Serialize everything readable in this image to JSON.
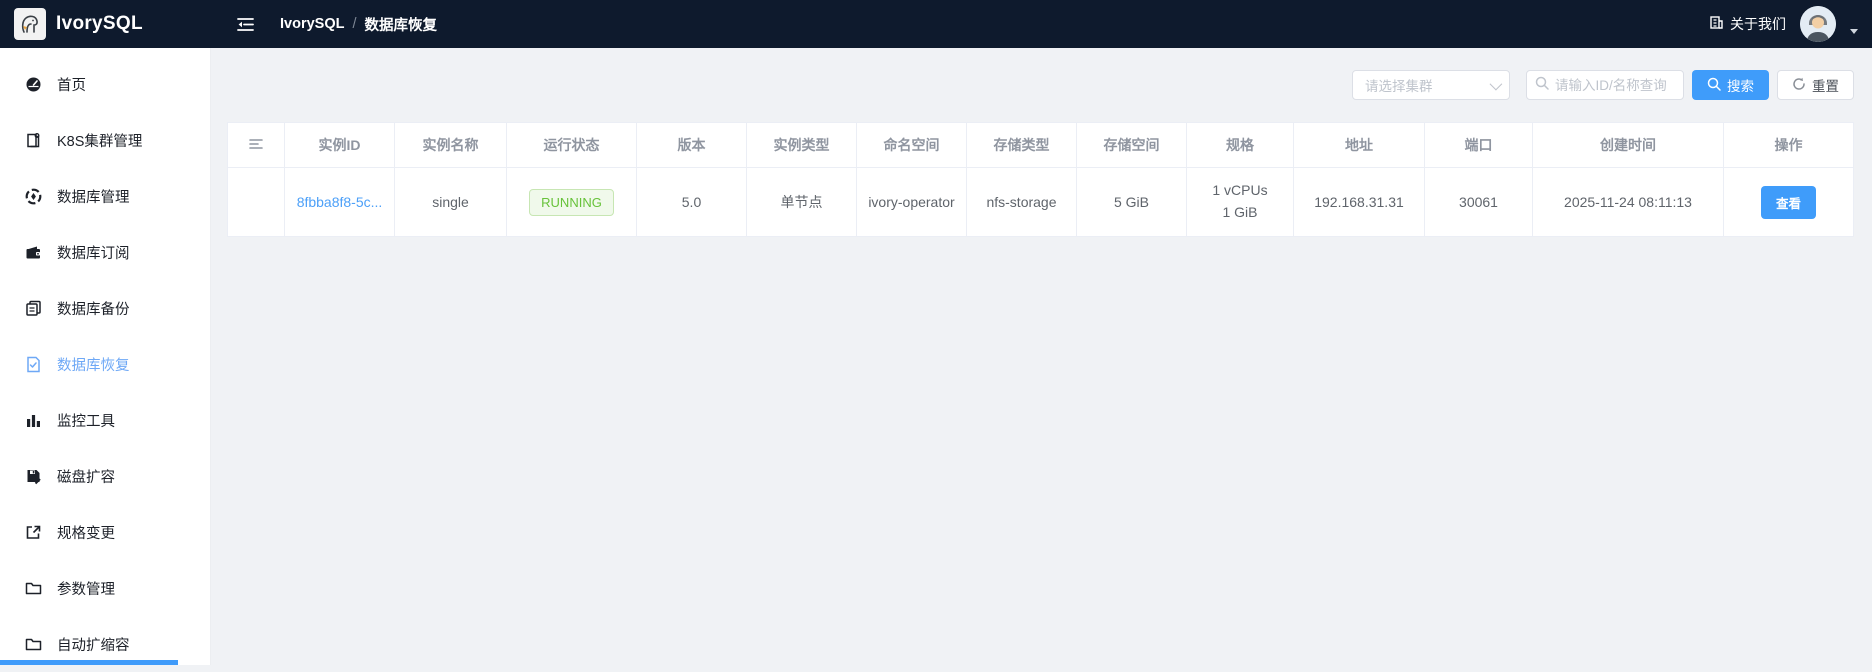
{
  "topbar": {
    "logo_text": "IvorySQL",
    "breadcrumb": {
      "root": "IvorySQL",
      "separator": "/",
      "current": "数据库恢复"
    },
    "about_label": "关于我们"
  },
  "sidebar": {
    "items": [
      {
        "label": "首页",
        "icon": "home-dashboard-icon",
        "active": false
      },
      {
        "label": "K8S集群管理",
        "icon": "k8s-cluster-icon",
        "active": false
      },
      {
        "label": "数据库管理",
        "icon": "database-manage-icon",
        "active": false
      },
      {
        "label": "数据库订阅",
        "icon": "database-subscribe-icon",
        "active": false
      },
      {
        "label": "数据库备份",
        "icon": "database-backup-icon",
        "active": false
      },
      {
        "label": "数据库恢复",
        "icon": "database-restore-icon",
        "active": true
      },
      {
        "label": "监控工具",
        "icon": "monitor-tools-icon",
        "active": false
      },
      {
        "label": "磁盘扩容",
        "icon": "disk-expand-icon",
        "active": false
      },
      {
        "label": "规格变更",
        "icon": "spec-change-icon",
        "active": false
      },
      {
        "label": "参数管理",
        "icon": "param-manage-icon",
        "active": false
      },
      {
        "label": "自动扩缩容",
        "icon": "autoscale-icon",
        "active": false
      }
    ]
  },
  "filters": {
    "cluster_select_placeholder": "请选择集群",
    "search_placeholder": "请输入ID/名称查询",
    "search_button": "搜索",
    "reset_button": "重置"
  },
  "table": {
    "headers": [
      "实例ID",
      "实例名称",
      "运行状态",
      "版本",
      "实例类型",
      "命名空间",
      "存储类型",
      "存储空间",
      "规格",
      "地址",
      "端口",
      "创建时间",
      "操作"
    ],
    "rows": [
      {
        "instance_id": "8fbba8f8-5c...",
        "instance_name": "single",
        "status": "RUNNING",
        "version": "5.0",
        "instance_type": "单节点",
        "namespace": "ivory-operator",
        "storage_type": "nfs-storage",
        "storage_space": "5 GiB",
        "spec_line1": "1 vCPUs",
        "spec_line2": "1 GiB",
        "address": "192.168.31.31",
        "port": "30061",
        "created_at": "2025-11-24 08:11:13",
        "action": "查看"
      }
    ]
  },
  "colors": {
    "topbar_bg": "#0e1a2d",
    "primary_blue": "#3f9cfa",
    "active_menu_blue": "#6ea8f6",
    "link_blue": "#4da0f8",
    "status_green": "#67c23a",
    "status_green_bg": "#f0f9eb",
    "main_bg": "#f0f2f5"
  }
}
